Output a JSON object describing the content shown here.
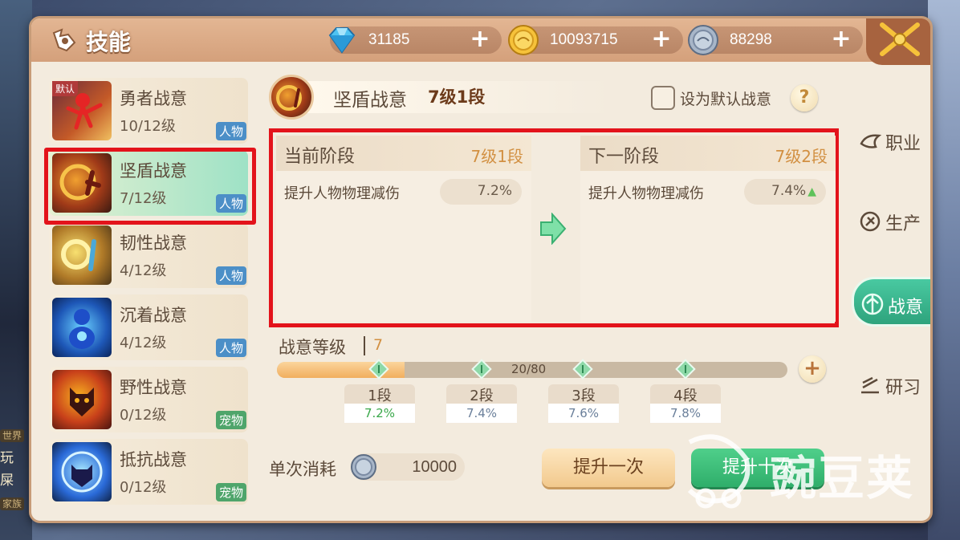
{
  "title": "技能",
  "currencies": [
    {
      "name": "diamond-icon",
      "value": "31185"
    },
    {
      "name": "gold-coin-icon",
      "value": "10093715"
    },
    {
      "name": "silver-coin-icon",
      "value": "88298"
    }
  ],
  "skills": [
    {
      "name": "勇者战意",
      "level": "10/12级",
      "type": "人物",
      "default_tag": "默认"
    },
    {
      "name": "坚盾战意",
      "level": "7/12级",
      "type": "人物"
    },
    {
      "name": "韧性战意",
      "level": "4/12级",
      "type": "人物"
    },
    {
      "name": "沉着战意",
      "level": "4/12级",
      "type": "人物"
    },
    {
      "name": "野性战意",
      "level": "0/12级",
      "type": "宠物"
    },
    {
      "name": "抵抗战意",
      "level": "0/12级",
      "type": "宠物"
    }
  ],
  "selected": {
    "name": "坚盾战意",
    "stage": "7级1段",
    "default_label": "设为默认战意",
    "help": "?"
  },
  "current_stage": {
    "title": "当前阶段",
    "stage": "7级1段",
    "stat": "提升人物物理减伤",
    "value": "7.2%"
  },
  "next_stage": {
    "title": "下一阶段",
    "stage": "7级2段",
    "stat": "提升人物物理减伤",
    "value": "7.4%"
  },
  "level": {
    "label": "战意等级",
    "value": "7",
    "progress_text": "20/80",
    "progress_fraction": 0.25,
    "segments": [
      {
        "label": "1段",
        "value": "7.2%"
      },
      {
        "label": "2段",
        "value": "7.4%"
      },
      {
        "label": "3段",
        "value": "7.6%"
      },
      {
        "label": "4段",
        "value": "7.8%"
      }
    ]
  },
  "cost": {
    "label": "单次消耗",
    "value": "10000"
  },
  "buttons": {
    "once": "提升一次",
    "ten": "提升十次"
  },
  "tabs": [
    {
      "label": "职业",
      "icon": "career-icon"
    },
    {
      "label": "生产",
      "icon": "production-icon"
    },
    {
      "label": "战意",
      "icon": "battle-spirit-icon"
    },
    {
      "label": "研习",
      "icon": "study-icon"
    }
  ],
  "watermark": "豌豆荚",
  "background_chat": {
    "tag": "世界",
    "line1": "玩",
    "line2": "屎",
    "tag2": "家族"
  },
  "colors": {
    "accent_red": "#e3131b",
    "header": "#d4a07b",
    "green_active": "#2ea37c"
  }
}
